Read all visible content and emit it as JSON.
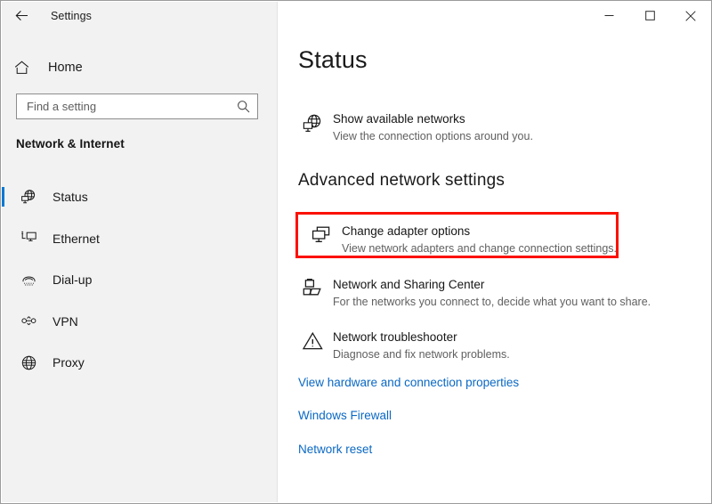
{
  "window": {
    "app_title": "Settings",
    "back_icon": "back-arrow-icon",
    "controls": {
      "minimize": "minimize-icon",
      "maximize": "maximize-icon",
      "close": "close-icon"
    }
  },
  "sidebar": {
    "home": {
      "label": "Home",
      "icon": "home-icon"
    },
    "search": {
      "value": "",
      "placeholder": "Find a setting",
      "icon": "search-icon"
    },
    "category_title": "Network & Internet",
    "selected_accent": "#0078d4",
    "items": [
      {
        "label": "Status",
        "icon": "globe-monitor-icon",
        "selected": true
      },
      {
        "label": "Ethernet",
        "icon": "ethernet-icon",
        "selected": false
      },
      {
        "label": "Dial-up",
        "icon": "dialup-icon",
        "selected": false
      },
      {
        "label": "VPN",
        "icon": "vpn-icon",
        "selected": false
      },
      {
        "label": "Proxy",
        "icon": "globe-icon",
        "selected": false
      }
    ]
  },
  "main": {
    "page_title": "Status",
    "show_networks": {
      "title": "Show available networks",
      "subtitle": "View the connection options around you.",
      "icon": "globe-monitor-icon"
    },
    "advanced_heading": "Advanced network settings",
    "tiles": [
      {
        "title": "Change adapter options",
        "subtitle": "View network adapters and change connection settings.",
        "icon": "adapter-monitor-icon",
        "highlighted": true
      },
      {
        "title": "Network and Sharing Center",
        "subtitle": "For the networks you connect to, decide what you want to share.",
        "icon": "sharing-center-icon",
        "highlighted": false
      },
      {
        "title": "Network troubleshooter",
        "subtitle": "Diagnose and fix network problems.",
        "icon": "warning-triangle-icon",
        "highlighted": false
      }
    ],
    "links": [
      {
        "label": "View hardware and connection properties"
      },
      {
        "label": "Windows Firewall"
      },
      {
        "label": "Network reset"
      }
    ],
    "highlight_color": "#fb1100",
    "link_color": "#0a68c4"
  }
}
